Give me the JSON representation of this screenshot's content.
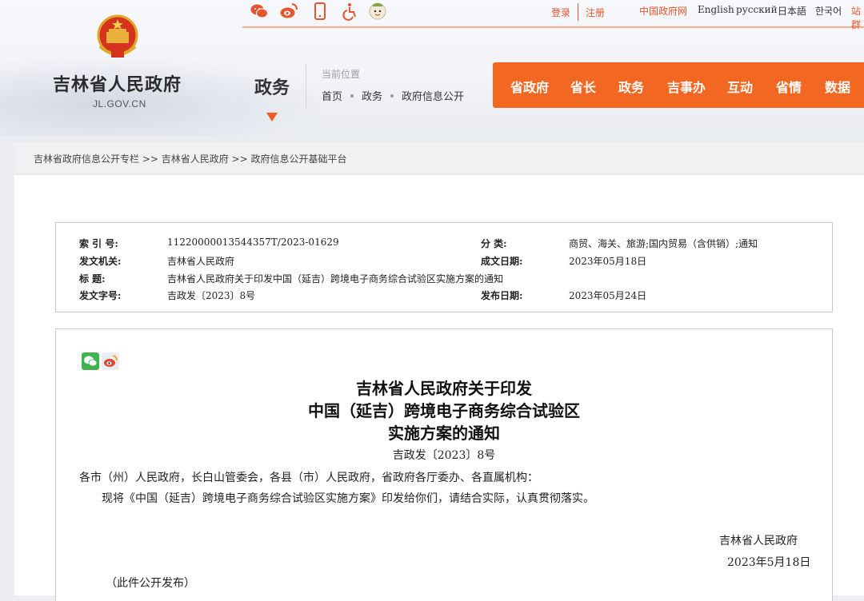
{
  "header": {
    "site_name": "吉林省人民政府",
    "site_domain": "JL.GOV.CN",
    "section": "政务",
    "location_label": "当前位置",
    "crumbs": [
      "首页",
      "政务",
      "政府信息公开"
    ],
    "login": "登录",
    "register": "注册",
    "links": [
      "中国政府网",
      "English",
      "русский",
      "日本語",
      "한국어",
      "站群"
    ],
    "social_icons": [
      "wechat-icon",
      "weibo-icon",
      "mobile-icon",
      "accessibility-icon",
      "mascot-icon"
    ]
  },
  "nav": [
    "省政府",
    "省长",
    "政务",
    "吉事办",
    "互动",
    "省情",
    "数据"
  ],
  "trail": "吉林省政府信息公开专栏 >> 吉林省人民政府 >> 政府信息公开基础平台",
  "meta": {
    "index_label": "索 引 号:",
    "index_value": "11220000013544357T/2023-01629",
    "category_label": "分    类:",
    "category_value": "商贸、海关、旅游;国内贸易（含供销）;通知",
    "issuer_label": "发文机关:",
    "issuer_value": "吉林省人民政府",
    "created_label": "成文日期:",
    "created_value": "2023年05月18日",
    "title_label": "标     题:",
    "title_value": "吉林省人民政府关于印发中国（延吉）跨境电子商务综合试验区实施方案的通知",
    "docno_label": "发文字号:",
    "docno_value": "吉政发〔2023〕8号",
    "published_label": "发布日期:",
    "published_value": "2023年05月24日"
  },
  "document": {
    "title_lines": [
      "吉林省人民政府关于印发",
      "中国（延吉）跨境电子商务综合试验区",
      "实施方案的通知"
    ],
    "doc_number": "吉政发〔2023〕8号",
    "recipients": "各市（州）人民政府，长白山管委会，各县（市）人民政府，省政府各厅委办、各直属机构：",
    "body": "现将《中国（延吉）跨境电子商务综合试验区实施方案》印发给你们，请结合实际，认真贯彻落实。",
    "signature": "吉林省人民政府",
    "date": "2023年5月18日",
    "footnote": "（此件公开发布）",
    "share_icons": [
      "wechat-share-icon",
      "weibo-share-icon"
    ]
  },
  "colors": {
    "accent": "#f26722",
    "link": "#e4572e"
  }
}
